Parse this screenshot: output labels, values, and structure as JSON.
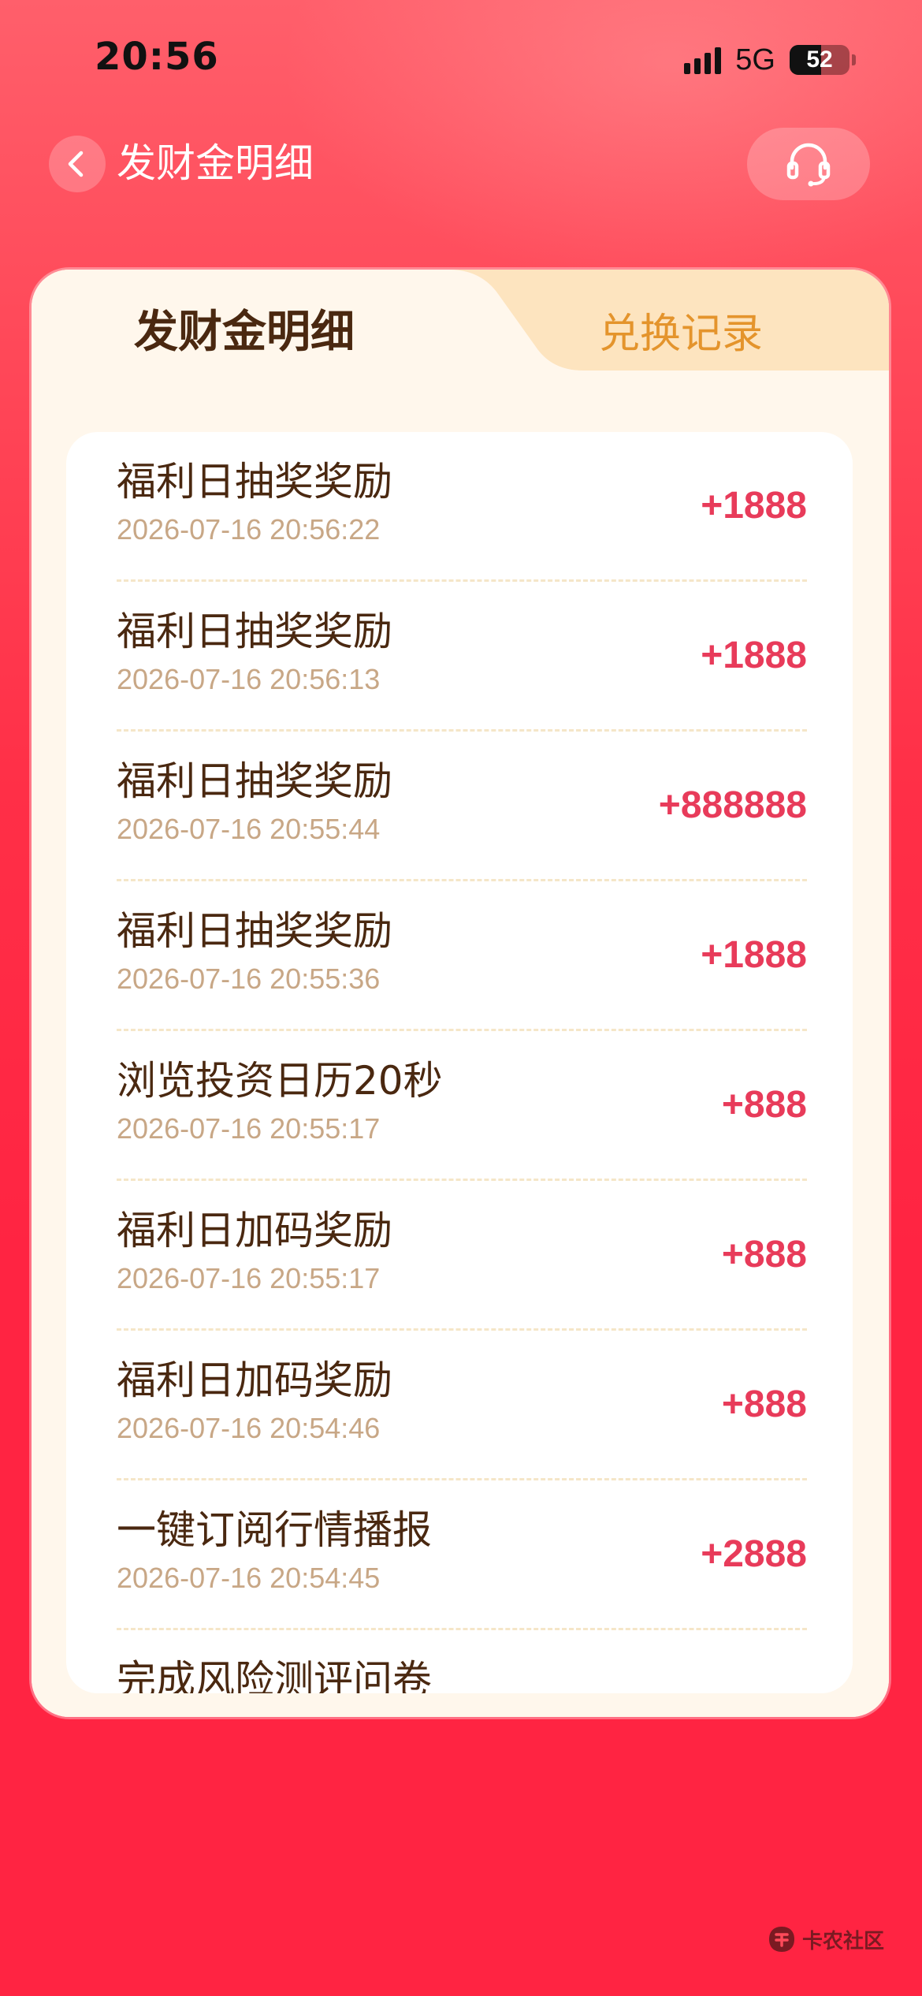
{
  "status_bar": {
    "time": "20:56",
    "network": "5G",
    "battery": "52",
    "battery_level": 0.52
  },
  "nav": {
    "title": "发财金明细",
    "back_icon": "chevron-left-icon",
    "service_icon": "headset-icon"
  },
  "tabs": [
    {
      "label": "发财金明细",
      "active": true
    },
    {
      "label": "兑换记录",
      "active": false
    }
  ],
  "records": [
    {
      "title": "福利日抽奖奖励",
      "time": "2026-07-16 20:56:22",
      "amount": "+1888"
    },
    {
      "title": "福利日抽奖奖励",
      "time": "2026-07-16 20:56:13",
      "amount": "+1888"
    },
    {
      "title": "福利日抽奖奖励",
      "time": "2026-07-16 20:55:44",
      "amount": "+888888"
    },
    {
      "title": "福利日抽奖奖励",
      "time": "2026-07-16 20:55:36",
      "amount": "+1888"
    },
    {
      "title": "浏览投资日历20秒",
      "time": "2026-07-16 20:55:17",
      "amount": "+888"
    },
    {
      "title": "福利日加码奖励",
      "time": "2026-07-16 20:55:17",
      "amount": "+888"
    },
    {
      "title": "福利日加码奖励",
      "time": "2026-07-16 20:54:46",
      "amount": "+888"
    },
    {
      "title": "一键订阅行情播报",
      "time": "2026-07-16 20:54:45",
      "amount": "+2888"
    },
    {
      "title": "完成风险测评问卷",
      "time": "",
      "amount": ""
    }
  ],
  "watermark": {
    "text": "卡农社区"
  },
  "colors": {
    "background": "#ff2442",
    "amount": "#e83b5a",
    "title_text": "#4a2810",
    "tab_inactive": "#e4942c",
    "time_text": "#c8a786"
  }
}
